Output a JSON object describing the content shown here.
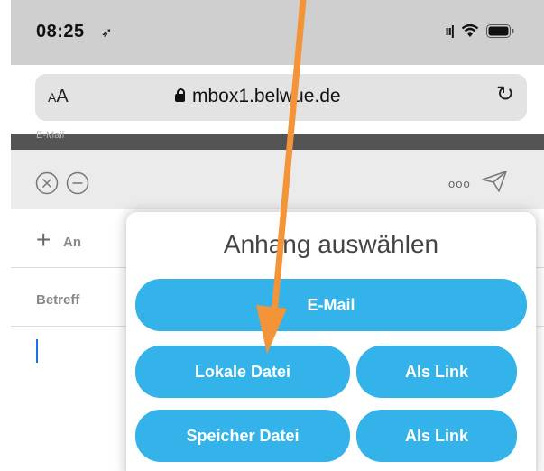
{
  "status_bar": {
    "time": "08:25",
    "location_glyph": "➶",
    "signal_glyph": "ıı|",
    "icons": [
      "location-arrow-icon",
      "signal-icon",
      "wifi-icon",
      "battery-icon"
    ]
  },
  "browser": {
    "aa_label": "AA",
    "url": "mbox1.belwue.de",
    "reload_glyph": "↻"
  },
  "mail": {
    "strip_label": "E-Mail",
    "toolbar": {
      "more_glyph": "ooo"
    },
    "fields": {
      "to_label": "An",
      "subject_label": "Betreff"
    }
  },
  "attachment_popup": {
    "title": "Anhang auswählen",
    "buttons": {
      "email": "E-Mail",
      "local_file": "Lokale Datei",
      "local_link": "Als Link",
      "storage_file": "Speicher Datei",
      "storage_link": "Als Link"
    }
  },
  "colors": {
    "accent_button": "#34b2ea",
    "annotation_arrow": "#f39439",
    "status_bar_bg": "#cfcfcf",
    "toolbar_bg": "#ebebeb"
  }
}
